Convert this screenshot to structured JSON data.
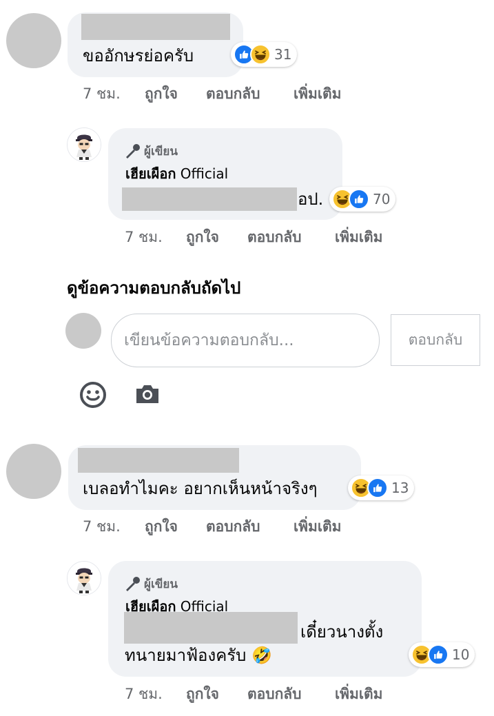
{
  "comments": [
    {
      "text": "ขออักษรย่อครับ",
      "reaction_count": "31",
      "actions": {
        "time": "7 ชม.",
        "like": "ถูกใจ",
        "reply": "ตอบกลับ",
        "more": "เพิ่มเติม"
      }
    },
    {
      "text": "เบลอทำไมคะ อยากเห็นหน้าจริงๆ",
      "reaction_count": "13",
      "actions": {
        "time": "7 ชม.",
        "like": "ถูกใจ",
        "reply": "ตอบกลับ",
        "more": "เพิ่มเติม"
      }
    }
  ],
  "replies": [
    {
      "author_tag": "ผู้เขียน",
      "author_name": "เฮียเผือก",
      "author_suffix": "Official",
      "text": "อป.",
      "reaction_count": "70",
      "actions": {
        "time": "7 ชม.",
        "like": "ถูกใจ",
        "reply": "ตอบกลับ",
        "more": "เพิ่มเติม"
      }
    },
    {
      "author_tag": "ผู้เขียน",
      "author_name": "เฮียเผือก",
      "author_suffix": "Official",
      "text_line1": "เดี๋ยวนางตั้ง",
      "text_line2": "ทนายมาฟ้องครับ",
      "emoji": "🤣",
      "reaction_count": "10",
      "actions": {
        "time": "7 ชม.",
        "like": "ถูกใจ",
        "reply": "ตอบกลับ",
        "more": "เพิ่มเติม"
      }
    }
  ],
  "view_more_replies": "ดูข้อความตอบกลับถัดไป",
  "reply_box": {
    "placeholder": "เขียนข้อความตอบกลับ...",
    "submit_label": "ตอบกลับ",
    "emoji_icon": "smiley-icon",
    "camera_icon": "camera-icon"
  },
  "colors": {
    "like": "#1877f2",
    "haha": "#f7c22f",
    "bubble": "#f0f2f5",
    "meta": "#65676b"
  }
}
